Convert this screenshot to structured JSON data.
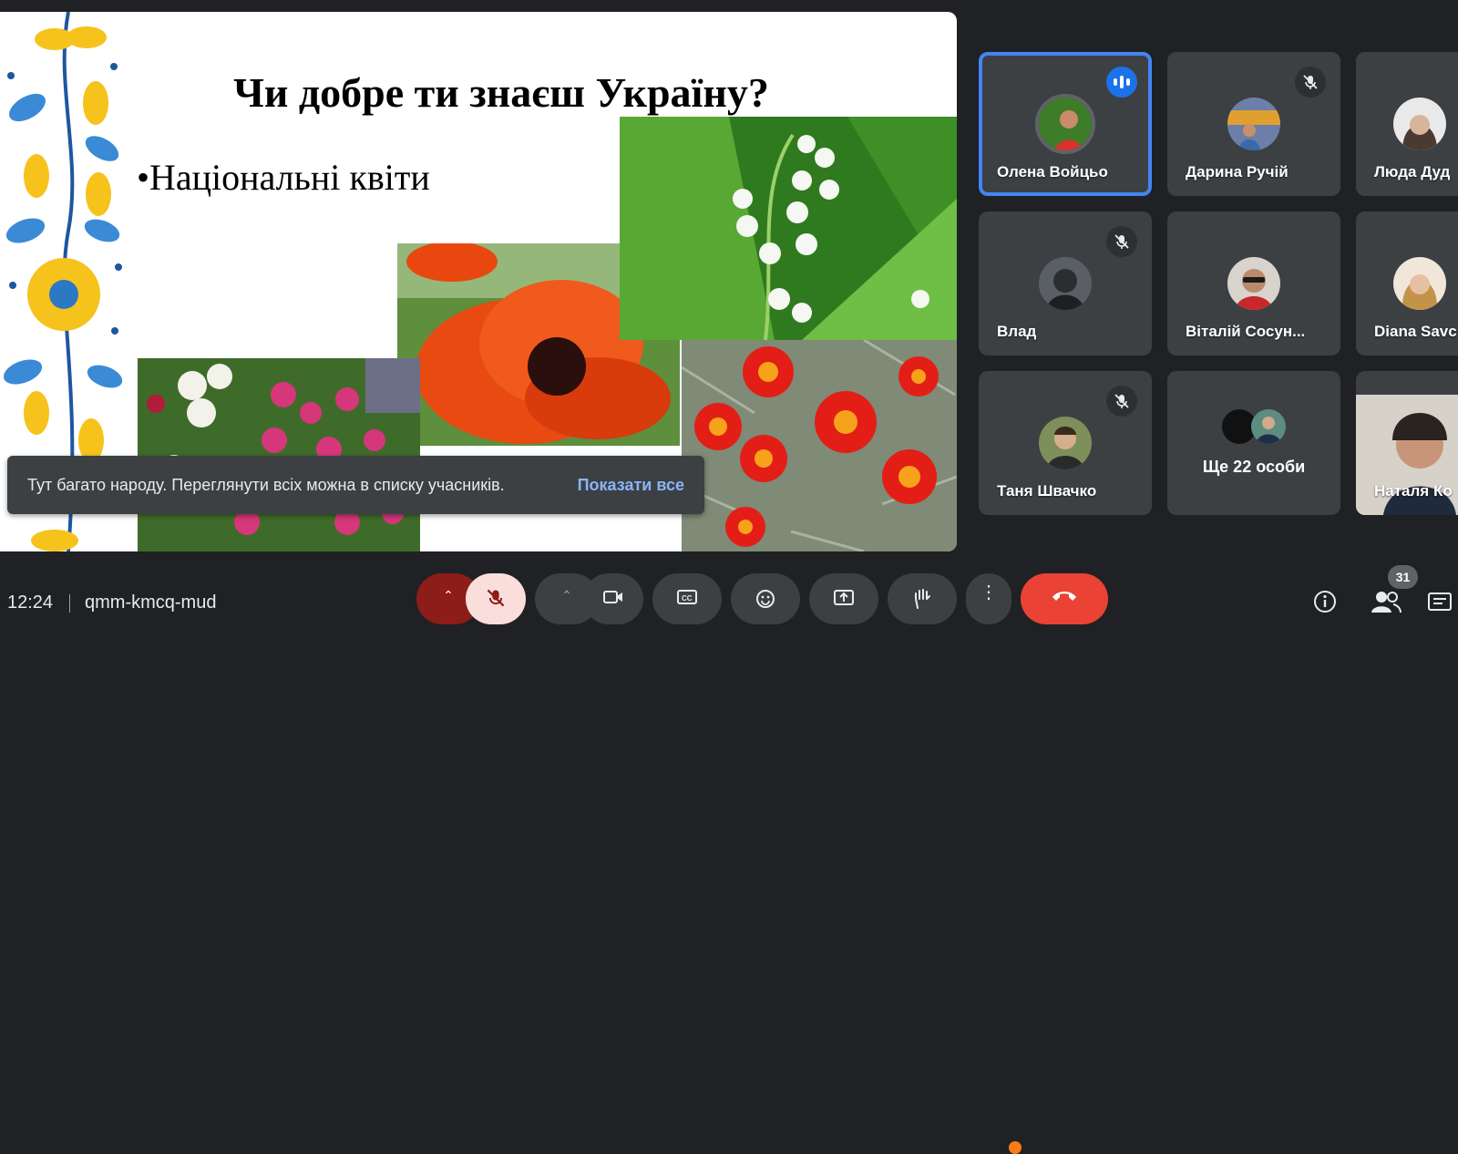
{
  "slide": {
    "title": "Чи добре ти знаєш Україну?",
    "bullet": "•Національні квіти"
  },
  "toast": {
    "message": "Тут багато народу. Переглянути всіх можна в списку учасників.",
    "action": "Показати все"
  },
  "participants": [
    {
      "name": "Олена Войцьо",
      "state": "speaking",
      "pinned": true
    },
    {
      "name": "Дарина Ручій",
      "state": "muted"
    },
    {
      "name": "Люда Дуд",
      "state": "muted"
    },
    {
      "name": "Влад",
      "state": "muted"
    },
    {
      "name": "Віталій Сосун...",
      "state": "muted"
    },
    {
      "name": "Diana Savc",
      "state": "muted"
    },
    {
      "name": "Таня Швачко",
      "state": "muted"
    },
    {
      "name": "Ще 22 особи",
      "state": "more"
    },
    {
      "name": "Наталя Ко",
      "state": "camera"
    }
  ],
  "bottom_bar": {
    "time": "12:24",
    "meeting_code": "qmm-kmcq-mud",
    "participant_count": "31"
  },
  "colors": {
    "accent": "#1a73e8",
    "leave": "#ea4335",
    "link": "#8ab4f8",
    "tile": "#3c4043",
    "background": "#202124"
  }
}
